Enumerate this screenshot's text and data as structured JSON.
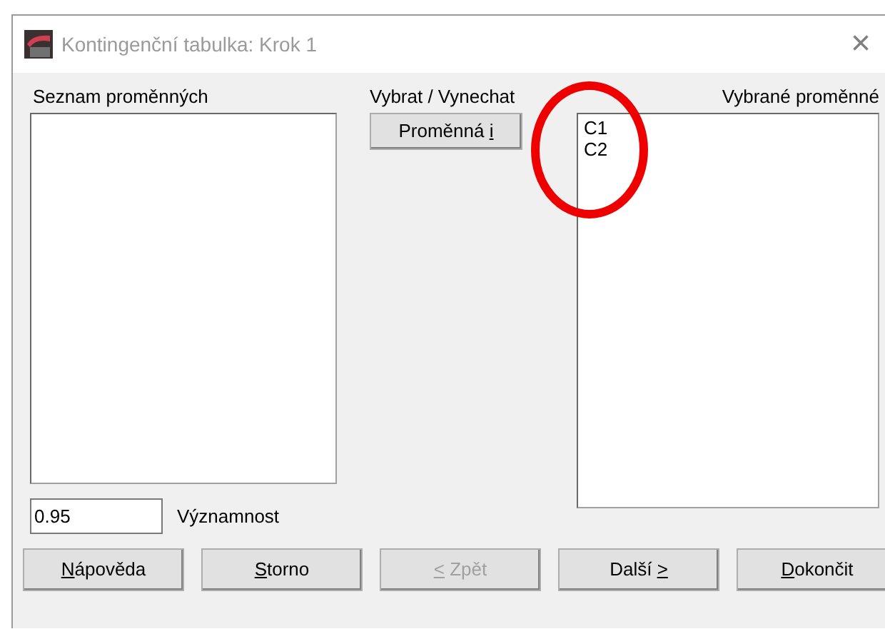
{
  "window": {
    "title": "Kontingenční tabulka: Krok 1",
    "close": "×"
  },
  "available": {
    "label": "Seznam proměnných"
  },
  "toggle": {
    "label": "Vybrat / Vynechat",
    "button": {
      "before": "Proměnná ",
      "key": "i"
    }
  },
  "selected": {
    "label": "Vybrané proměnné",
    "items": [
      "C1",
      "C2"
    ]
  },
  "significance": {
    "value": "0.95",
    "label": "Významnost"
  },
  "annotation": {
    "kind": "circle",
    "color": "#ee0000"
  },
  "buttons": [
    {
      "key": "N",
      "after": "ápověda",
      "disabled": false
    },
    {
      "key": "S",
      "after": "torno",
      "disabled": false
    },
    {
      "key": "<",
      "after": " Zpět",
      "disabled": true
    },
    {
      "before": "Další ",
      "key": ">",
      "disabled": false
    },
    {
      "key": "D",
      "after": "okončit",
      "disabled": false
    }
  ]
}
